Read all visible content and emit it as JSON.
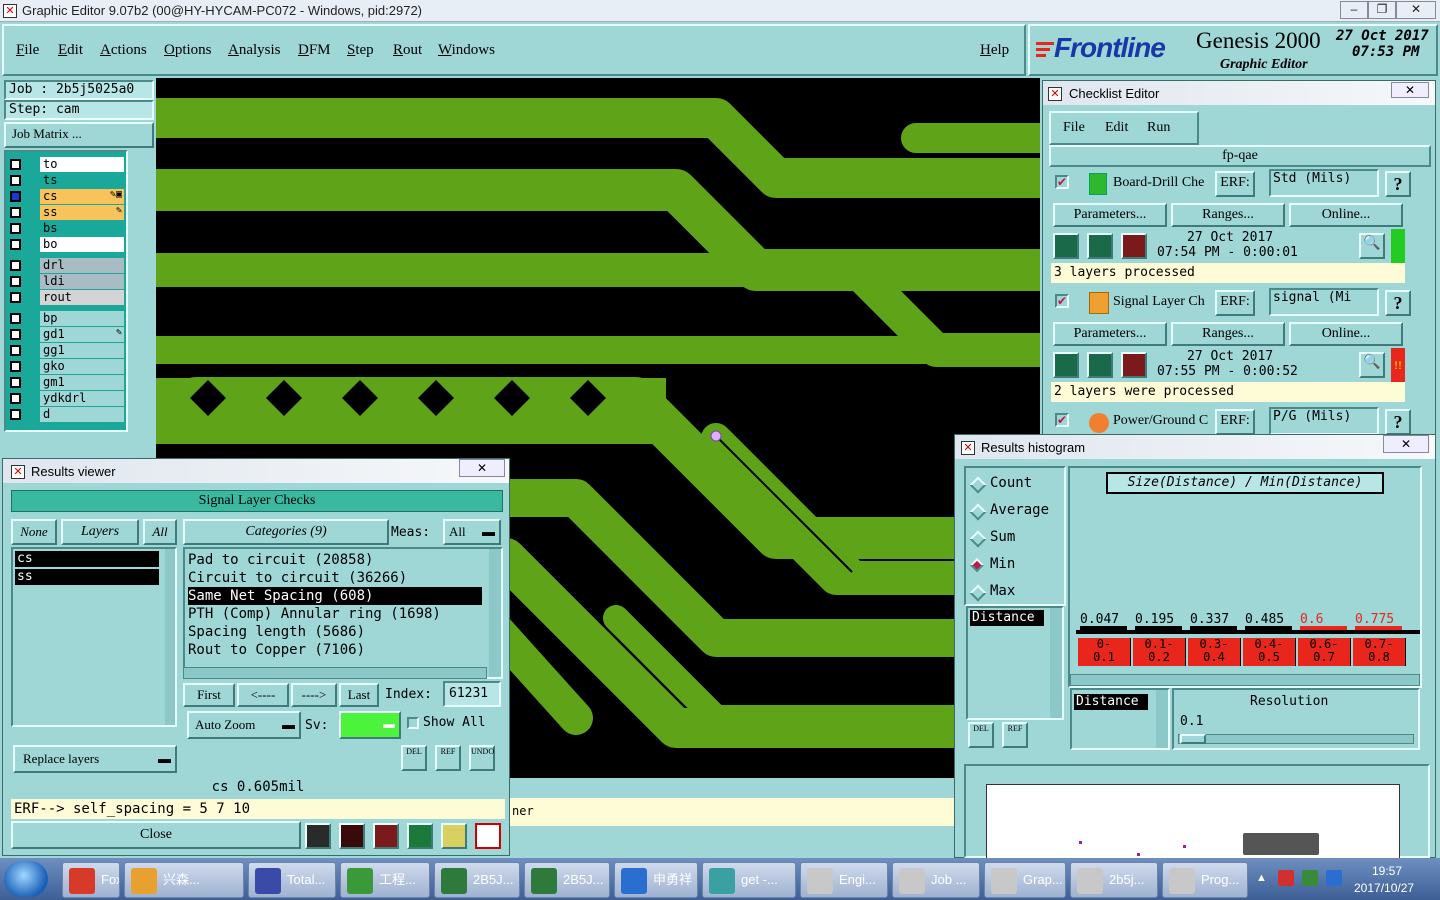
{
  "window": {
    "title": "Graphic Editor 9.07b2 (00@HY-HYCAM-PC072 - Windows, pid:2972)"
  },
  "menu": {
    "items": [
      "File",
      "Edit",
      "Actions",
      "Options",
      "Analysis",
      "DFM",
      "Step",
      "Rout",
      "Windows"
    ],
    "help": "Help"
  },
  "brand": {
    "logo": "Frontline",
    "product": "Genesis 2000",
    "subtitle": "Graphic Editor",
    "date": "27 Oct 2017",
    "time": "07:53 PM"
  },
  "job": {
    "job_label": "Job  : 2b5j5025a0",
    "step_label": "Step: cam",
    "matrix_button": "Job Matrix ..."
  },
  "layers": [
    {
      "name": "to",
      "color": "#ffffff",
      "mark": ""
    },
    {
      "name": "ts",
      "color": "#1aa89a",
      "mark": ""
    },
    {
      "name": "cs",
      "color": "#f7c35a",
      "mark": "✎▣",
      "active": true
    },
    {
      "name": "ss",
      "color": "#f7c35a",
      "mark": "✎"
    },
    {
      "name": "bs",
      "color": "#1aa89a",
      "mark": ""
    },
    {
      "name": "bo",
      "color": "#ffffff",
      "mark": ""
    },
    {
      "name": "drl",
      "color": "#a9bcc4",
      "mark": ""
    },
    {
      "name": "ldi",
      "color": "#a9bcc4",
      "mark": ""
    },
    {
      "name": "rout",
      "color": "#d4d4d4",
      "mark": ""
    },
    {
      "name": "bp",
      "color": "#9fd6d6",
      "mark": ""
    },
    {
      "name": "gd1",
      "color": "#9fd6d6",
      "mark": "✎"
    },
    {
      "name": "gg1",
      "color": "#9fd6d6",
      "mark": ""
    },
    {
      "name": "gko",
      "color": "#9fd6d6",
      "mark": ""
    },
    {
      "name": "gm1",
      "color": "#9fd6d6",
      "mark": ""
    },
    {
      "name": "ydkdrl",
      "color": "#9fd6d6",
      "mark": ""
    },
    {
      "name": "d",
      "color": "#9fd6d6",
      "mark": ""
    }
  ],
  "checklist": {
    "title": "Checklist Editor",
    "menu": [
      "File",
      "Edit",
      "Run"
    ],
    "name": "fp-qae",
    "checks": [
      {
        "name": "Board-Drill Che",
        "erf": "ERF:",
        "erf_value": "Std (Mils)",
        "params": "Parameters...",
        "ranges": "Ranges...",
        "online": "Online...",
        "date": "27 Oct 2017",
        "time": "07:54 PM - 0:00:01",
        "status": "3 layers processed",
        "status_color": "#22cc22"
      },
      {
        "name": "Signal Layer Ch",
        "erf": "ERF:",
        "erf_value": "signal (Mi",
        "params": "Parameters...",
        "ranges": "Ranges...",
        "online": "Online...",
        "date": "27 Oct 2017",
        "time": "07:55 PM - 0:00:52",
        "status": "2 layers were processed",
        "status_color": "#e8261b"
      },
      {
        "name": "Power/Ground C",
        "erf": "ERF:",
        "erf_value": "P/G (Mils)"
      }
    ],
    "help_glyph": "?"
  },
  "results_viewer": {
    "title": "Results viewer",
    "header": "Signal Layer Checks",
    "none": "None",
    "layers": "Layers",
    "all": "All",
    "layer_list": [
      "cs",
      "ss"
    ],
    "categories": "Categories (9)",
    "meas_label": "Meas:",
    "meas_value": "All",
    "category_list": [
      "Pad to circuit (20858)",
      "Circuit to circuit (36266)",
      "Same Net Spacing (608)",
      "PTH (Comp) Annular ring (1698)",
      "Spacing length (5686)",
      "Rout to Copper (7106)"
    ],
    "selected_index": 2,
    "nav": {
      "first": "First",
      "prev": "<----",
      "next": "---->",
      "last": "Last",
      "index_label": "Index:",
      "index_value": "61231"
    },
    "auto_zoom": "Auto Zoom",
    "sv_label": "Sv:",
    "show_all": "Show All",
    "replace_layers": "Replace layers",
    "measurement": "cs 0.605mil",
    "erf_line": "ERF--> self_spacing = 5 7 10",
    "close": "Close",
    "icons": [
      "DEL",
      "REF",
      "UNDO"
    ]
  },
  "histogram": {
    "title": "Results histogram",
    "heading": "Size(Distance) / Min(Distance)",
    "options": [
      "Count",
      "Average",
      "Sum",
      "Min",
      "Max"
    ],
    "selected_option": "Min",
    "list_item": "Distance",
    "values": [
      "0.047",
      "0.195",
      "0.337",
      "0.485",
      "0.6",
      "0.775"
    ],
    "value_colors": [
      "#000000",
      "#000000",
      "#000000",
      "#000000",
      "#e8261b",
      "#e8261b"
    ],
    "bins": [
      "0-\n0.1",
      "0.1-\n0.2",
      "0.3-\n0.4",
      "0.4-\n0.5",
      "0.6-\n0.7",
      "0.7-\n0.8"
    ],
    "distance_label": "Distance",
    "resolution_label": "Resolution",
    "resolution_value": "0.1",
    "icons": [
      "DEL",
      "REF"
    ]
  },
  "status_fragment": "ner",
  "taskbar": {
    "items": [
      {
        "label": "Foxm...",
        "color": "#d83a2a"
      },
      {
        "label": "兴森...",
        "color": "#e8a030"
      },
      {
        "label": "Total...",
        "color": "#3a4aa8"
      },
      {
        "label": "工程...",
        "color": "#3a9a3a"
      },
      {
        "label": "2B5J...",
        "color": "#2d7a3a"
      },
      {
        "label": "2B5J...",
        "color": "#2d7a3a"
      },
      {
        "label": "申勇祥",
        "color": "#2a6fd0"
      },
      {
        "label": "get -...",
        "color": "#3aa0a0"
      },
      {
        "label": "Engi...",
        "color": "#c8c8c8"
      },
      {
        "label": "Job ...",
        "color": "#c8c8c8"
      },
      {
        "label": "Grap...",
        "color": "#c8c8c8"
      },
      {
        "label": "2b5j...",
        "color": "#c8c8c8"
      },
      {
        "label": "Prog...",
        "color": "#c8c8c8"
      }
    ],
    "clock_time": "19:57",
    "clock_date": "2017/10/27"
  }
}
